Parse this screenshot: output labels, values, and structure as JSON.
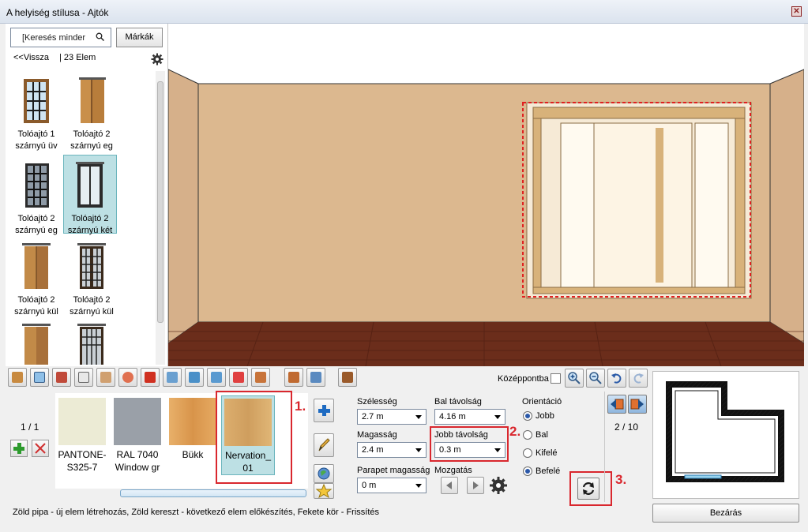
{
  "window": {
    "title": "A helyiség stílusa - Ajtók",
    "close_glyph": "✕"
  },
  "browser": {
    "search_placeholder": "[Keresés minder",
    "brands_label": "Márkák",
    "back_label": "<<Vissza",
    "count_label": "| 23 Elem",
    "items": [
      {
        "line1": "Tolóajtó 1",
        "line2": "szárnyú üv"
      },
      {
        "line1": "Tolóajtó 2",
        "line2": "szárnyú eg"
      },
      {
        "line1": "Tolóajtó 2",
        "line2": "szárnyú eg"
      },
      {
        "line1": "Tolóajtó 2",
        "line2": "szárnyú két"
      },
      {
        "line1": "Tolóajtó 2",
        "line2": "szárnyú kül"
      },
      {
        "line1": "Tolóajtó 2",
        "line2": "szárnyú kül"
      }
    ],
    "selected_index": 3
  },
  "toolbar": {
    "center_label": "Középpontba"
  },
  "materials": {
    "page": "1 / 1",
    "items": [
      {
        "line1": "PANTONE-",
        "line2": "S325-7",
        "color": "#ecebd5"
      },
      {
        "line1": "RAL 7040",
        "line2": "Window gr",
        "color": "#9aa0a8"
      },
      {
        "line1": "Bükk",
        "line2": "",
        "color": "#e2a55e"
      },
      {
        "line1": "Nervation_",
        "line2": "01",
        "color": "#dcae6e"
      }
    ],
    "selected_index": 3
  },
  "props": {
    "width_label": "Szélesség",
    "width_value": "2.7 m",
    "left_dist_label": "Bal távolság",
    "left_dist_value": "4.16 m",
    "height_label": "Magasság",
    "height_value": "2.4 m",
    "right_dist_label": "Jobb távolság",
    "right_dist_value": "0.3 m",
    "parapet_label": "Parapet magasság",
    "parapet_value": "0 m",
    "move_label": "Mozgatás",
    "orientation_label": "Orientáció",
    "orientation_options": [
      "Jobb",
      "Bal",
      "Kifelé",
      "Befelé"
    ],
    "orientation_selected": [
      "Jobb",
      "Befelé"
    ]
  },
  "annotations": {
    "step1": "1.",
    "step2": "2.",
    "step3": "3."
  },
  "plan_nav": {
    "page": "2 / 10"
  },
  "status_text": "Zöld pipa - új elem létrehozás, Zöld kereszt - következő elem előkészítés, Fekete kör - Frissítés",
  "close_button": "Bezárás",
  "colors": {
    "wall": "#dcb88f",
    "floor": "#6b2d1b",
    "door_frame": "#d8b27a",
    "selection": "#bde0e4",
    "annotation": "#d9272e"
  }
}
